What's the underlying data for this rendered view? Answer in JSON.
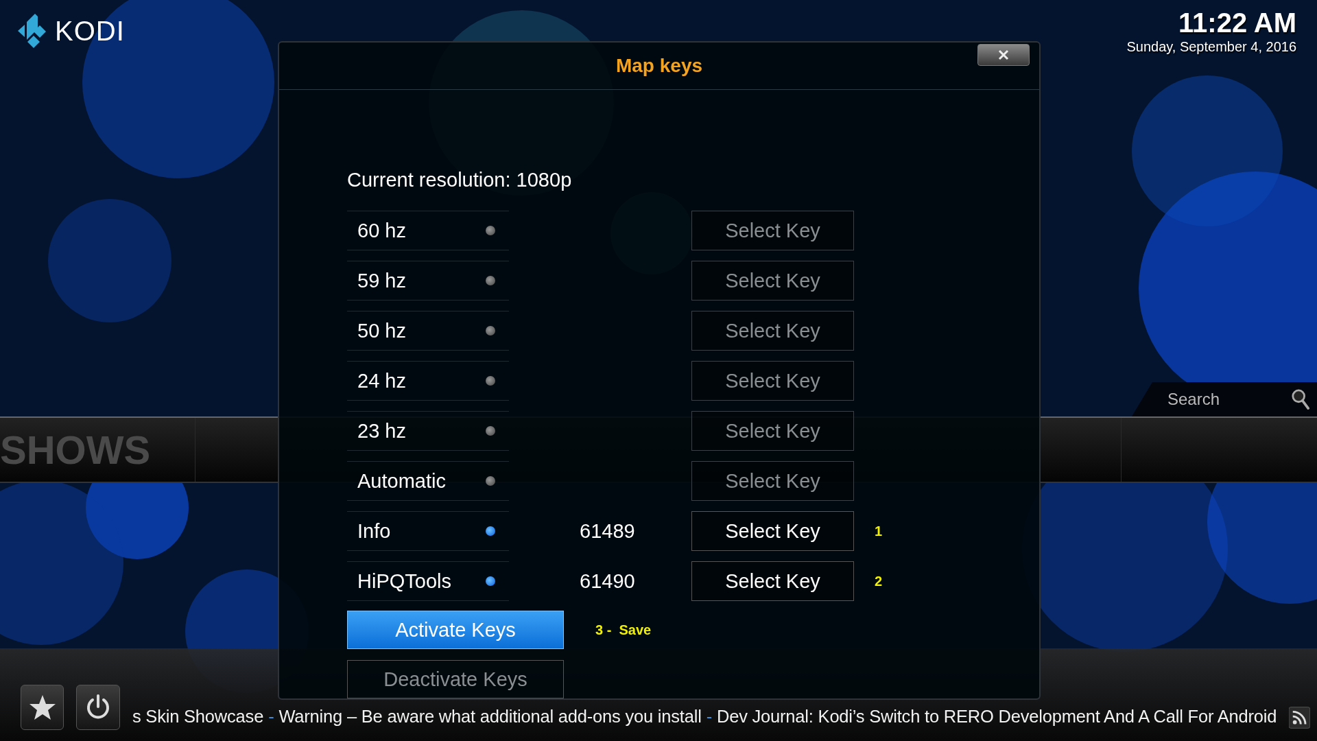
{
  "brand": {
    "name": "KODI"
  },
  "clock": {
    "time": "11:22 AM",
    "date": "Sunday, September 4, 2016"
  },
  "search": {
    "label": "Search"
  },
  "main_menu": [
    {
      "label": "SHOWS"
    }
  ],
  "dialog": {
    "title": "Map keys",
    "resolution": "Current resolution: 1080p",
    "rows": [
      {
        "label": "60 hz",
        "on": false,
        "button": "Select Key",
        "disabled": true
      },
      {
        "label": "59 hz",
        "on": false,
        "button": "Select Key",
        "disabled": true
      },
      {
        "label": "50 hz",
        "on": false,
        "button": "Select Key",
        "disabled": true
      },
      {
        "label": "24 hz",
        "on": false,
        "button": "Select Key",
        "disabled": true
      },
      {
        "label": "23 hz",
        "on": false,
        "button": "Select Key",
        "disabled": true
      },
      {
        "label": "Automatic",
        "on": false,
        "button": "Select Key",
        "disabled": true
      },
      {
        "label": "Info",
        "on": true,
        "value": "61489",
        "button": "Select Key",
        "disabled": false,
        "note": "1"
      },
      {
        "label": "HiPQTools",
        "on": true,
        "value": "61490",
        "button": "Select Key",
        "disabled": false,
        "note": "2"
      }
    ],
    "actions": [
      {
        "label": "Activate Keys",
        "focused": true,
        "disabled": false,
        "note": "3 -  Save"
      },
      {
        "label": "Deactivate Keys",
        "focused": false,
        "disabled": true
      }
    ]
  },
  "ticker": {
    "separator": "-",
    "items": [
      "s Skin Showcase",
      "Warning – Be aware what additional add-ons you install",
      "Dev Journal: Kodi’s Switch to RERO Development And A Call For Android"
    ]
  }
}
